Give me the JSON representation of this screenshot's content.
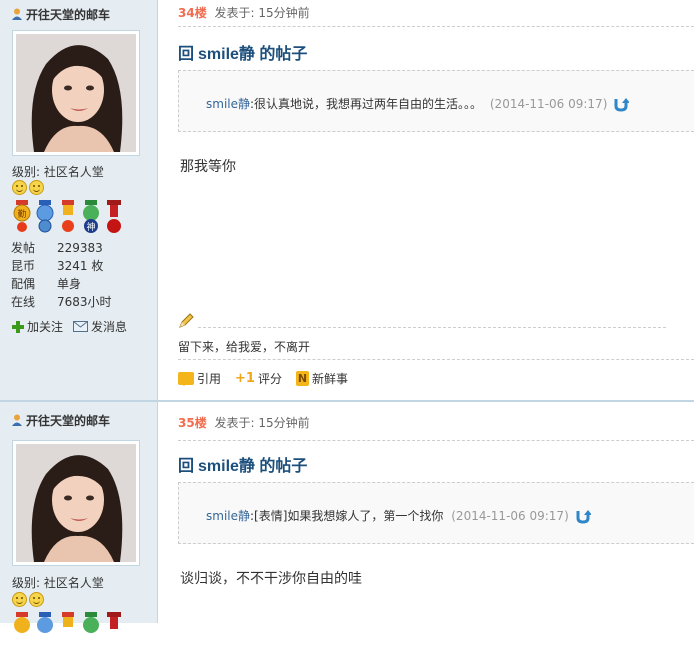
{
  "posts": [
    {
      "author": "开往天堂的邮车",
      "level_label": "级别:",
      "level": "社区名人堂",
      "stats": [
        {
          "label": "发帖",
          "value": "229383"
        },
        {
          "label": "昆币",
          "value": "3241 枚"
        },
        {
          "label": "配偶",
          "value": "单身"
        },
        {
          "label": "在线",
          "value": "7683小时"
        }
      ],
      "actions": {
        "follow": "加关注",
        "message": "发消息"
      },
      "floor": "34楼",
      "posted": "发表于: 15分钟前",
      "title_prefix": "回",
      "title": "smile静 的帖子",
      "quote": {
        "author": "smile静",
        "text": ":很认真地说，我想再过两年自由的生活。。。",
        "time": "(2014-11-06 09:17)"
      },
      "body": "那我等你",
      "signature": "留下来，给我爱，不离开",
      "footer": {
        "quote": "引用",
        "rate": "评分",
        "fresh": "新鲜事",
        "rate_prefix": "+1"
      }
    },
    {
      "author": "开往天堂的邮车",
      "level_label": "级别:",
      "level": "社区名人堂",
      "floor": "35楼",
      "posted": "发表于: 15分钟前",
      "title_prefix": "回",
      "title": "smile静 的帖子",
      "quote": {
        "author": "smile静",
        "text": ":[表情]如果我想嫁人了，第一个找你",
        "time": "(2014-11-06 09:17)"
      },
      "body": "谈归谈，不不干涉你自由的哇"
    }
  ],
  "colors": {
    "sidebar_bg": "#e5edf2",
    "floor": "#f26c4f",
    "title": "#1d4f7c",
    "quote_author": "#336699"
  }
}
